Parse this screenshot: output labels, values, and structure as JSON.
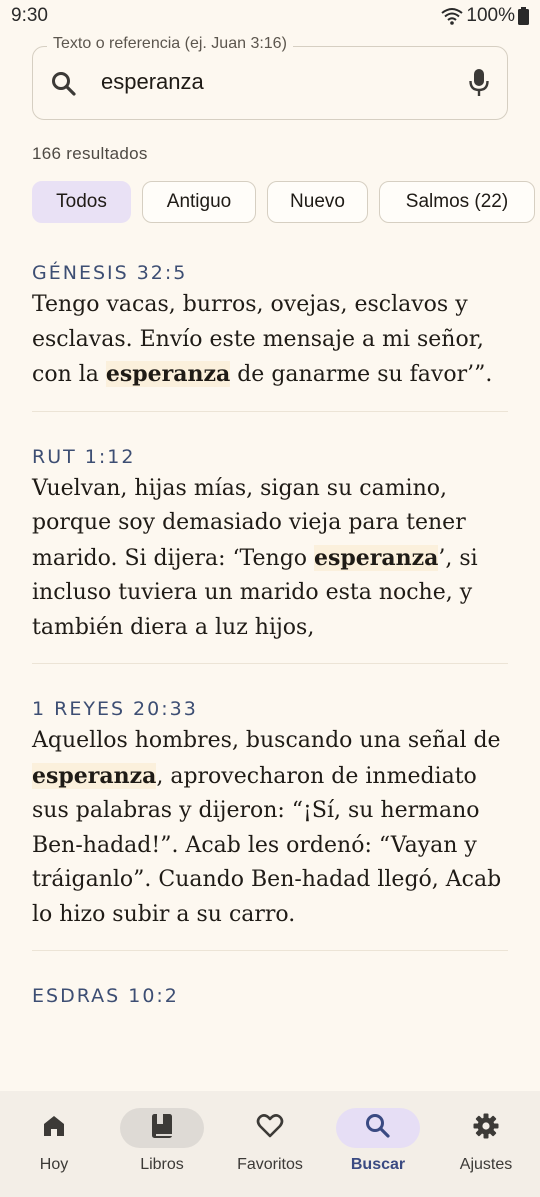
{
  "status": {
    "time": "9:30",
    "battery": "100%"
  },
  "search": {
    "label": "Texto o referencia (ej. Juan 3:16)",
    "value": "esperanza"
  },
  "results_count": "166 resultados",
  "chips": [
    "Todos",
    "Antiguo",
    "Nuevo",
    "Salmos (22)"
  ],
  "verses": [
    {
      "ref": "GÉNESIS 32:5",
      "before": "Tengo vacas, burros, ovejas, esclavos y esclavas. Envío este mensaje a mi señor, con la ",
      "highlight": "esperanza",
      "after": " de ganarme su favor’”."
    },
    {
      "ref": "RUT 1:12",
      "before": "Vuelvan, hijas mías, sigan su camino, porque soy demasiado vieja para tener marido. Si dijera: ‘Tengo ",
      "highlight": "esperanza",
      "after": "’, si incluso tuviera un marido esta noche, y también diera a luz hijos,"
    },
    {
      "ref": "1 REYES 20:33",
      "before": "Aquellos hombres, buscando una señal de ",
      "highlight": "esperanza",
      "after": ", aprovecharon de inmediato sus palabras y dijeron: “¡Sí, su hermano Ben-hadad!”. Acab les ordenó: “Vayan y tráiganlo”. Cuando Ben-hadad llegó, Acab lo hizo subir a su carro."
    },
    {
      "ref": "ESDRAS 10:2",
      "before": "",
      "highlight": "",
      "after": ""
    }
  ],
  "nav": [
    {
      "label": "Hoy",
      "icon": "home-icon"
    },
    {
      "label": "Libros",
      "icon": "book-icon"
    },
    {
      "label": "Favoritos",
      "icon": "heart-icon"
    },
    {
      "label": "Buscar",
      "icon": "search-icon"
    },
    {
      "label": "Ajustes",
      "icon": "gear-icon"
    }
  ],
  "colors": {
    "accent": "#3a4a82",
    "highlight_bg": "#FBF0DC",
    "chip_selected": "#E9E1F5"
  }
}
